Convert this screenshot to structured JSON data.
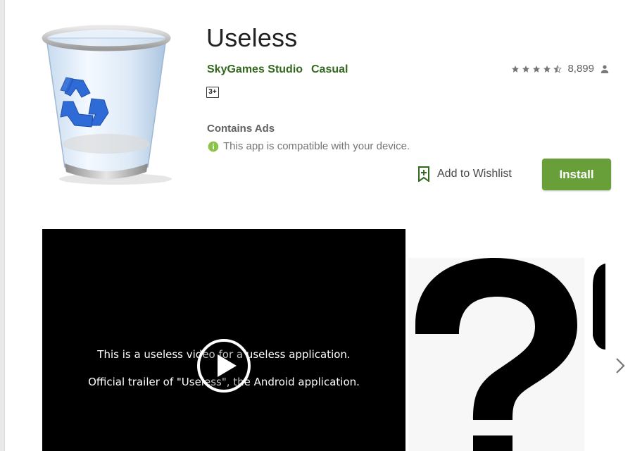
{
  "app": {
    "title": "Useless",
    "developer": "SkyGames Studio",
    "category": "Casual",
    "content_rating": "3+",
    "rating_stars": 4.5,
    "rating_count": "8,899",
    "contains_ads": "Contains Ads",
    "compatibility": "This app is compatible with your device."
  },
  "actions": {
    "wishlist_label": "Add to Wishlist",
    "install_label": "Install"
  },
  "media": {
    "video_line_1": "This is a useless video for a useless application.",
    "video_line_2": "Official trailer of \"Useless\", the Android application."
  },
  "icons": {
    "app_icon": "recycle-bin-icon",
    "rating_user": "person-icon",
    "compat_info": "info-icon",
    "wishlist": "bookmark-add-icon",
    "play": "play-icon",
    "carousel_next": "chevron-right-icon"
  },
  "colors": {
    "accent": "#689f38",
    "link": "#33691e",
    "text_secondary": "#616161"
  }
}
